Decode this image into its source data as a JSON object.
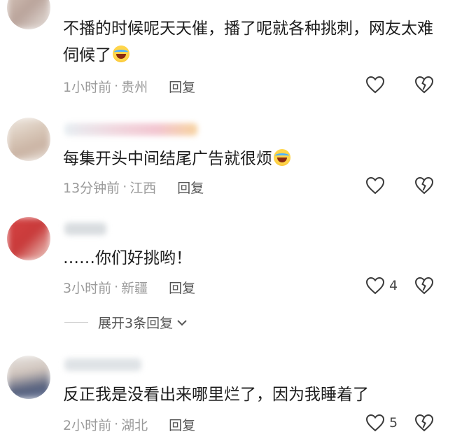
{
  "comments": [
    {
      "text": "不播的时候呢天天催，播了呢就各种挑刺，网友太难伺候了",
      "time": "1小时前",
      "location": "贵州",
      "reply_label": "回复",
      "likes": ""
    },
    {
      "text": "每集开头中间结尾广告就很烦",
      "time": "13分钟前",
      "location": "江西",
      "reply_label": "回复",
      "likes": ""
    },
    {
      "text": "……你们好挑哟！",
      "time": "3小时前",
      "location": "新疆",
      "reply_label": "回复",
      "likes": "4"
    },
    {
      "text": "反正我是没看出来哪里烂了，因为我睡着了",
      "time": "2小时前",
      "location": "湖北",
      "reply_label": "回复",
      "likes": "5"
    }
  ],
  "expand_replies": "展开3条回复",
  "icons": {
    "like": "heart-outline-icon",
    "dislike": "broken-heart-icon",
    "expand": "chevron-down-icon",
    "emoji": "laughing-crying-emoji-icon"
  },
  "meta_separator": "·"
}
